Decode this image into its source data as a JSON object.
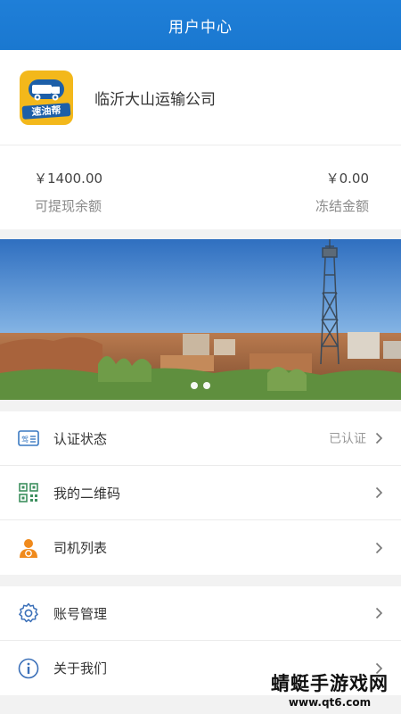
{
  "header": {
    "title": "用户中心"
  },
  "profile": {
    "logo_text": "速油帮",
    "company_name": "临沂大山运输公司"
  },
  "balance": {
    "withdrawable_value": "￥1400.00",
    "withdrawable_label": "可提现余额",
    "frozen_value": "￥0.00",
    "frozen_label": "冻结金额"
  },
  "banner": {
    "slide_count": 2,
    "active_index": 0
  },
  "menu": {
    "group1": [
      {
        "label": "认证状态",
        "status": "已认证",
        "icon": "id-card-icon"
      },
      {
        "label": "我的二维码",
        "icon": "qr-code-icon"
      },
      {
        "label": "司机列表",
        "icon": "driver-icon"
      }
    ],
    "group2": [
      {
        "label": "账号管理",
        "icon": "gear-icon"
      },
      {
        "label": "关于我们",
        "icon": "info-icon"
      }
    ]
  },
  "watermark": {
    "title": "蜻蜓手游戏网",
    "url": "www.qt6.com"
  },
  "colors": {
    "header_bg": "#1a78d0",
    "accent_orange": "#f08a1c",
    "logo_yellow": "#f3b81b",
    "logo_blue": "#1d5fa8"
  }
}
